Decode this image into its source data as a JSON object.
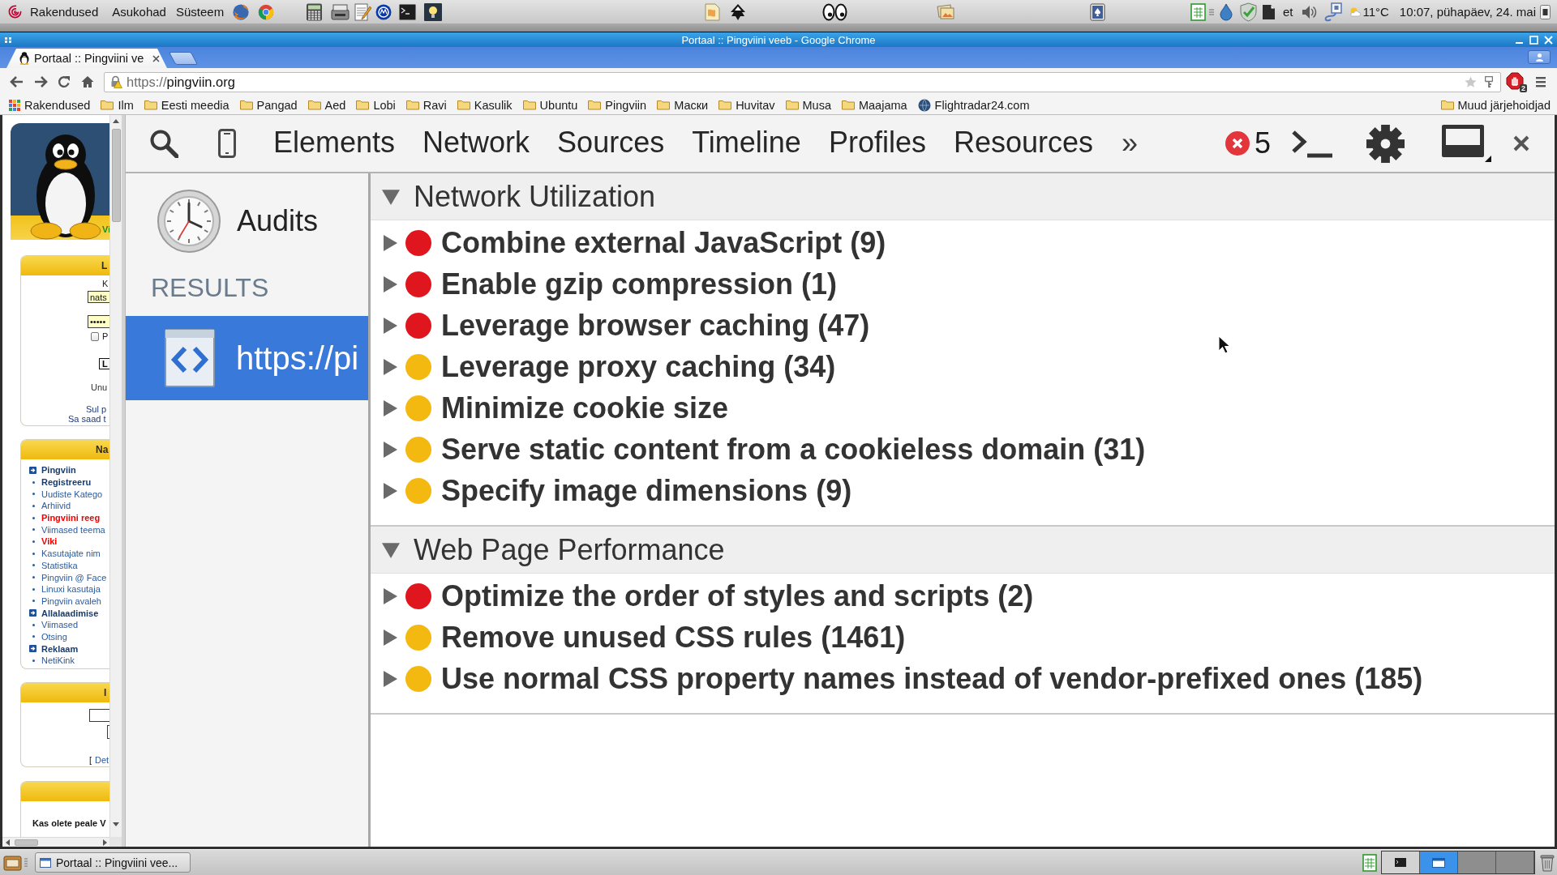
{
  "top_panel": {
    "menus": [
      "Rakendused",
      "Asukohad",
      "Süsteem"
    ],
    "keyboard_layout": "et",
    "temperature": "11°C",
    "clock": "10:07, pühapäev, 24. mai"
  },
  "window": {
    "title": "Portaal :: Pingviini veeb - Google Chrome"
  },
  "browser": {
    "tabs": [
      {
        "title": "Portaal :: Pingviini ve",
        "selected": true
      }
    ],
    "url": {
      "scheme": "https://",
      "host": "pingviin.org"
    },
    "extension_badge": "2",
    "bookmarks": [
      {
        "kind": "apps",
        "label": "Rakendused"
      },
      {
        "kind": "folder",
        "label": "Ilm"
      },
      {
        "kind": "folder",
        "label": "Eesti meedia"
      },
      {
        "kind": "folder",
        "label": "Pangad"
      },
      {
        "kind": "folder",
        "label": "Aed"
      },
      {
        "kind": "folder",
        "label": "Lobi"
      },
      {
        "kind": "folder",
        "label": "Ravi"
      },
      {
        "kind": "folder",
        "label": "Kasulik"
      },
      {
        "kind": "folder",
        "label": "Ubuntu"
      },
      {
        "kind": "folder",
        "label": "Pingviin"
      },
      {
        "kind": "folder",
        "label": "Маски"
      },
      {
        "kind": "folder",
        "label": "Huvitav"
      },
      {
        "kind": "folder",
        "label": "Musa"
      },
      {
        "kind": "folder",
        "label": "Maajama"
      },
      {
        "kind": "site",
        "label": "Flightradar24.com"
      }
    ],
    "other_bookmarks": "Muud järjehoidjad"
  },
  "page": {
    "banner_text": "Vi",
    "login": {
      "header": "L",
      "username_label": "K",
      "username": "nats",
      "password": "•••••",
      "remember_label": "P",
      "remember_checked": false,
      "button": "L",
      "link": "Unu",
      "note": [
        "Sul p",
        "Sa saad t"
      ]
    },
    "nav": {
      "header": "Na",
      "items": [
        {
          "kind": "section",
          "label": "Pingviin"
        },
        {
          "kind": "strong",
          "label": "Registreeru"
        },
        {
          "kind": "link",
          "label": "Uudiste Katego"
        },
        {
          "kind": "link",
          "label": "Arhiivid"
        },
        {
          "kind": "alert",
          "label": "Pingviini reeg"
        },
        {
          "kind": "link",
          "label": "Viimased teema"
        },
        {
          "kind": "alert",
          "label": "Viki"
        },
        {
          "kind": "link",
          "label": "Kasutajate nim"
        },
        {
          "kind": "link",
          "label": "Statistika"
        },
        {
          "kind": "link",
          "label": "Pingviin @ Face"
        },
        {
          "kind": "link",
          "label": "Linuxi kasutaja"
        },
        {
          "kind": "link",
          "label": "Pingviin avaleh"
        },
        {
          "kind": "section",
          "label": "Allalaadimise"
        },
        {
          "kind": "link",
          "label": "Viimased"
        },
        {
          "kind": "link",
          "label": "Otsing"
        },
        {
          "kind": "section",
          "label": "Reklaam"
        },
        {
          "kind": "link",
          "label": "NetiKink"
        }
      ]
    },
    "box": {
      "header": "I",
      "link_prefix": "[",
      "link": "Det"
    },
    "poll": {
      "question": "Kas olete peale V"
    }
  },
  "devtools": {
    "tabs": [
      {
        "label": "Elements",
        "selected": false
      },
      {
        "label": "Network",
        "selected": false
      },
      {
        "label": "Sources",
        "selected": false
      },
      {
        "label": "Timeline",
        "selected": false
      },
      {
        "label": "Profiles",
        "selected": false
      },
      {
        "label": "Resources",
        "selected": false
      }
    ],
    "overflow": "»",
    "error_count": "5",
    "sidebar": {
      "title": "Audits",
      "results_heading": "RESULTS",
      "results": [
        {
          "label": "https://pi",
          "selected": true
        }
      ]
    },
    "sections": [
      {
        "title": "Network Utilization",
        "expanded": true,
        "rules": [
          {
            "label": "Combine external JavaScript (9)",
            "color": "#e0161e",
            "expanded": false
          },
          {
            "label": "Enable gzip compression (1)",
            "color": "#e0161e",
            "expanded": false
          },
          {
            "label": "Leverage browser caching (47)",
            "color": "#e0161e",
            "expanded": false
          },
          {
            "label": "Leverage proxy caching (34)",
            "color": "#f4b911",
            "expanded": false
          },
          {
            "label": "Minimize cookie size",
            "color": "#f4b911",
            "expanded": false
          },
          {
            "label": "Serve static content from a cookieless domain (31)",
            "color": "#f4b911",
            "expanded": false
          },
          {
            "label": "Specify image dimensions (9)",
            "color": "#f4b911",
            "expanded": false
          }
        ]
      },
      {
        "title": "Web Page Performance",
        "expanded": true,
        "rules": [
          {
            "label": "Optimize the order of styles and scripts (2)",
            "color": "#e0161e",
            "expanded": false
          },
          {
            "label": "Remove unused CSS rules (1461)",
            "color": "#f4b911",
            "expanded": false
          },
          {
            "label": "Use normal CSS property names instead of vendor-prefixed ones (185)",
            "color": "#f4b911",
            "expanded": false
          }
        ]
      }
    ]
  },
  "taskbar": {
    "windows": [
      {
        "label": "Portaal :: Pingviini vee...",
        "selected": false
      }
    ],
    "workspaces": [
      {
        "selected": false,
        "kind": "terminal"
      },
      {
        "selected": true,
        "kind": "browser"
      },
      {
        "selected": false,
        "kind": "empty"
      },
      {
        "selected": false,
        "kind": "empty"
      }
    ]
  }
}
